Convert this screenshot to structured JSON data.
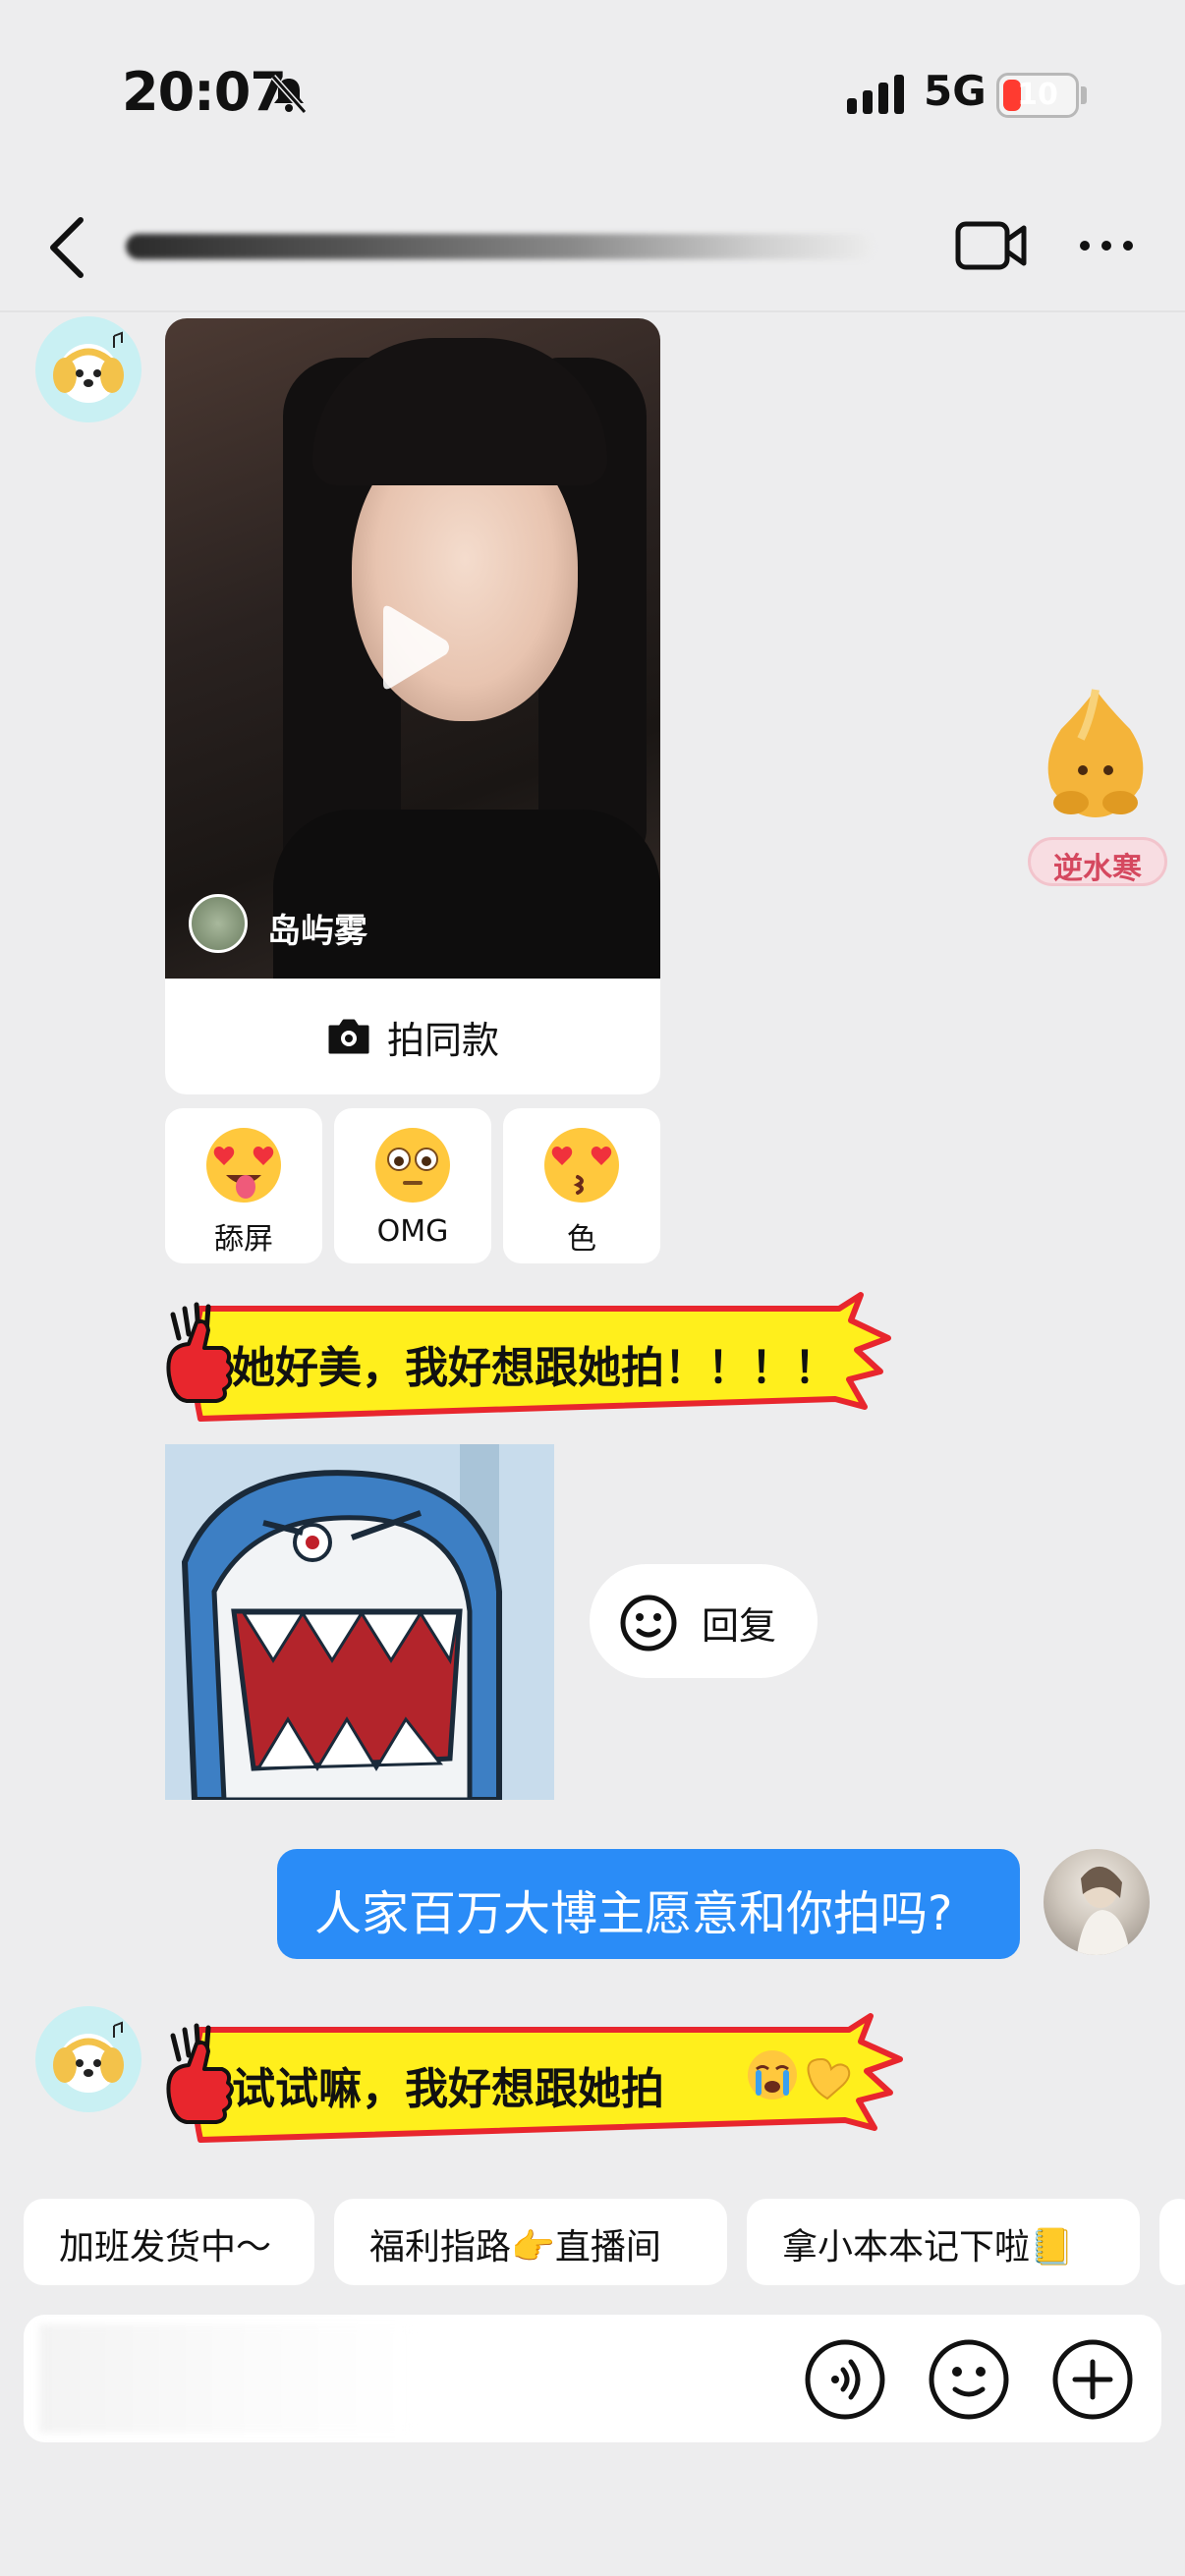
{
  "status_bar": {
    "time": "20:07",
    "network": "5G",
    "battery": "10"
  },
  "header": {
    "title": ""
  },
  "mascot": {
    "label": "逆水寒"
  },
  "video_card": {
    "author": "岛屿雾",
    "same_style_label": "拍同款"
  },
  "reactions": [
    {
      "label": "舔屏",
      "icon": "heart-eyes-tongue-emoji"
    },
    {
      "label": "OMG",
      "icon": "flushed-emoji"
    },
    {
      "label": "色",
      "icon": "heart-eyes-kiss-emoji"
    }
  ],
  "messages": {
    "bot_1": "她好美，我好想跟她拍！！！！",
    "reply_button": "回复",
    "user_1": "人家百万大博主愿意和你拍吗?",
    "bot_2": "试试嘛，我好想跟她拍"
  },
  "quick_replies": [
    "加班发货中～",
    "福利指路👉直播间",
    "拿小本本记下啦📒"
  ],
  "input": {
    "placeholder": ""
  },
  "colors": {
    "accent": "#2a8cf7",
    "bubble_yellow": "#ffef1c",
    "bubble_border": "#e8262d"
  }
}
